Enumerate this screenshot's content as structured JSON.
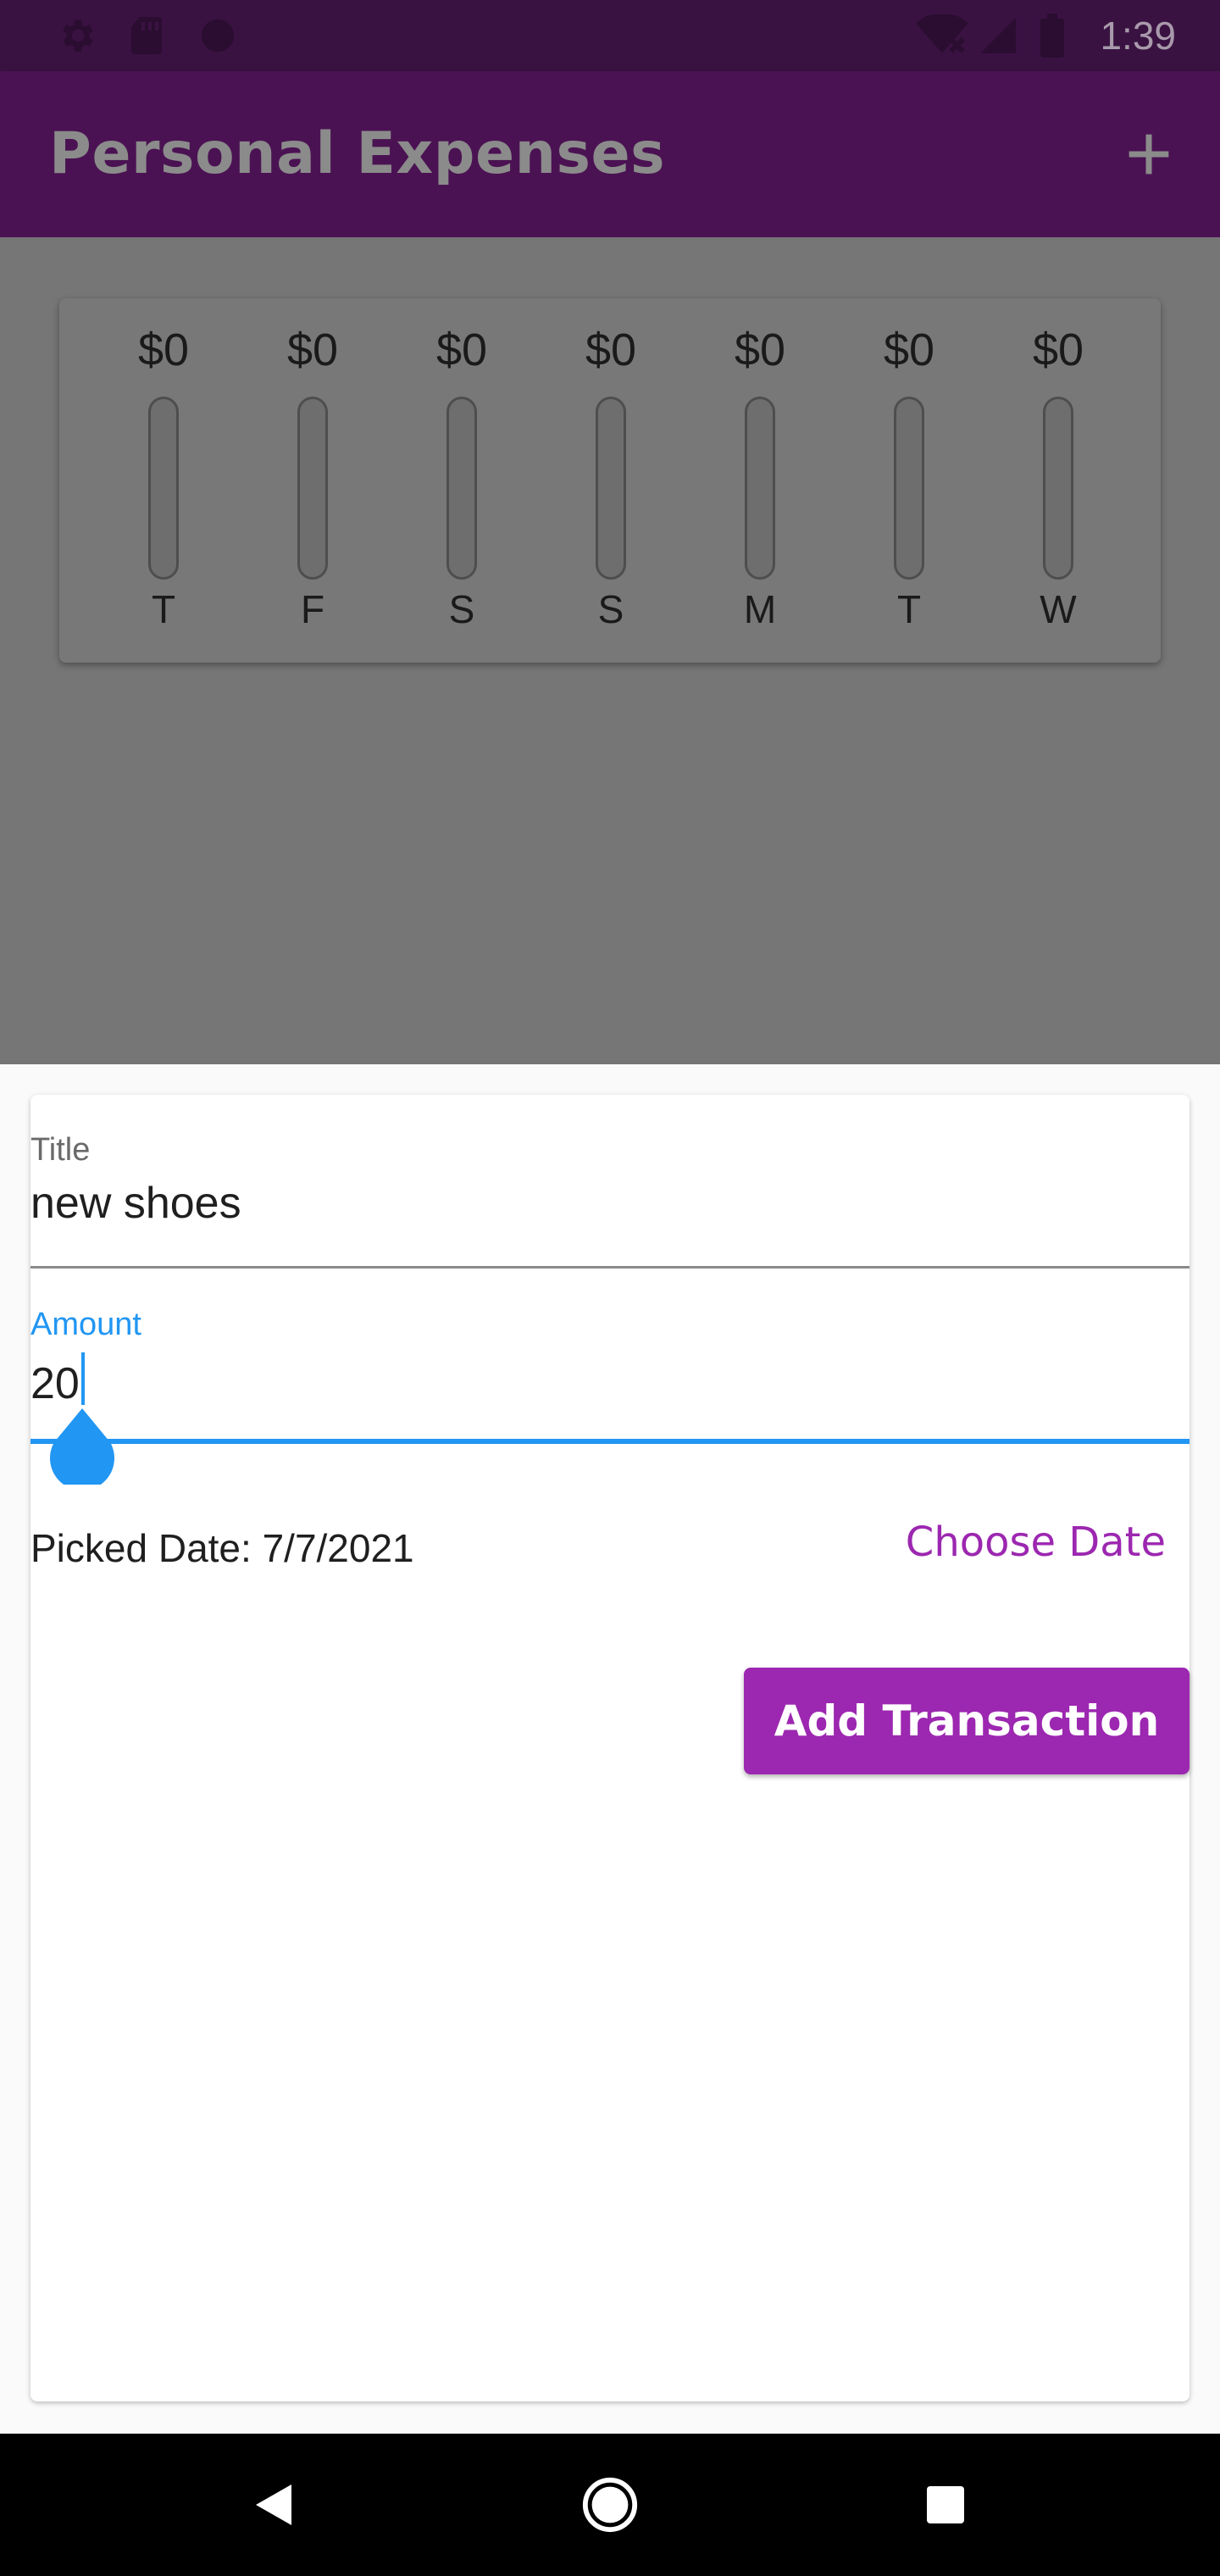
{
  "status_bar": {
    "time": "1:39",
    "icons_left": [
      "settings-icon",
      "sd-card-icon",
      "circle-icon"
    ],
    "icons_right": [
      "wifi-off-icon",
      "signal-icon",
      "battery-icon"
    ]
  },
  "app_bar": {
    "title": "Personal Expenses",
    "action_icon": "plus-icon"
  },
  "chart": {
    "bars": [
      {
        "day": "T",
        "amount": "$0",
        "fraction": 0
      },
      {
        "day": "F",
        "amount": "$0",
        "fraction": 0
      },
      {
        "day": "S",
        "amount": "$0",
        "fraction": 0
      },
      {
        "day": "S",
        "amount": "$0",
        "fraction": 0
      },
      {
        "day": "M",
        "amount": "$0",
        "fraction": 0
      },
      {
        "day": "T",
        "amount": "$0",
        "fraction": 0
      },
      {
        "day": "W",
        "amount": "$0",
        "fraction": 0
      }
    ]
  },
  "form": {
    "title_label": "Title",
    "title_value": "new shoes",
    "amount_label": "Amount",
    "amount_value": "20",
    "picked_date": "Picked Date: 7/7/2021",
    "choose_date_label": "Choose Date",
    "submit_label": "Add Transaction"
  },
  "colors": {
    "primary": "#9c27b0",
    "primary_dark": "#4b1253",
    "focus": "#2196f3"
  },
  "nav_bar": {
    "icons": [
      "back-icon",
      "home-icon",
      "recents-icon"
    ]
  }
}
